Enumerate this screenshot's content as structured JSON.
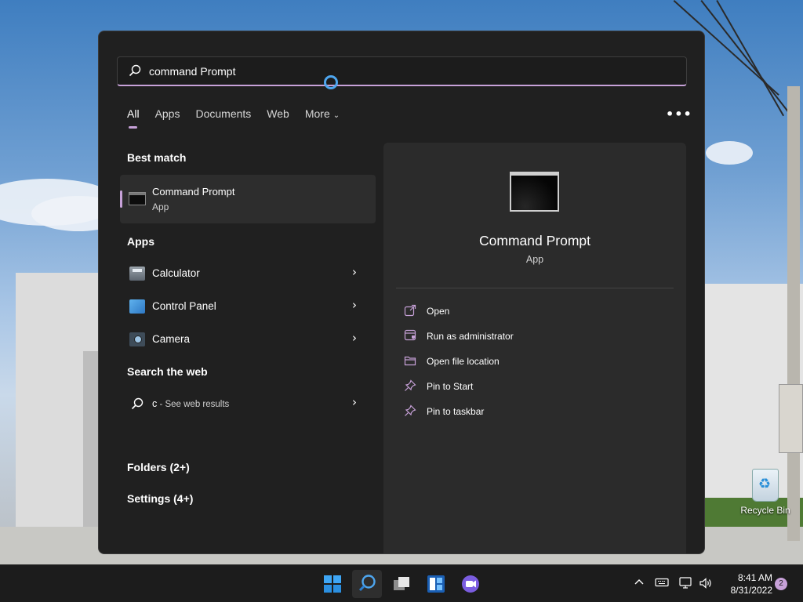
{
  "search": {
    "value": "command Prompt",
    "placeholder": ""
  },
  "tabs": [
    {
      "label": "All"
    },
    {
      "label": "Apps"
    },
    {
      "label": "Documents"
    },
    {
      "label": "Web"
    },
    {
      "label": "More"
    }
  ],
  "more_options_label": "•••",
  "best_match": {
    "heading": "Best match",
    "name": "Command Prompt",
    "type": "App"
  },
  "apps": {
    "heading": "Apps",
    "items": [
      {
        "label": "Calculator",
        "icon": "calculator-icon"
      },
      {
        "label": "Control Panel",
        "icon": "control-panel-icon"
      },
      {
        "label": "Camera",
        "icon": "camera-icon"
      }
    ]
  },
  "search_web": {
    "heading": "Search the web",
    "query": "c",
    "suffix": " - See web results"
  },
  "folders": {
    "label": "Folders (2+)"
  },
  "settings": {
    "label": "Settings (4+)"
  },
  "preview": {
    "name": "Command Prompt",
    "type": "App",
    "actions": [
      {
        "label": "Open",
        "icon": "open-external-icon"
      },
      {
        "label": "Run as administrator",
        "icon": "shield-window-icon"
      },
      {
        "label": "Open file location",
        "icon": "folder-icon"
      },
      {
        "label": "Pin to Start",
        "icon": "pin-icon"
      },
      {
        "label": "Pin to taskbar",
        "icon": "pin-icon"
      }
    ]
  },
  "desktop": {
    "recycle_bin_label": "Recycle Bin"
  },
  "taskbar": {
    "time": "8:41 AM",
    "date": "8/31/2022",
    "notification_count": "2"
  },
  "colors": {
    "accent": "#c7a1d8",
    "panel_bg": "#202020",
    "preview_bg": "#2b2b2b",
    "busy_ring": "#4ea6ef"
  }
}
